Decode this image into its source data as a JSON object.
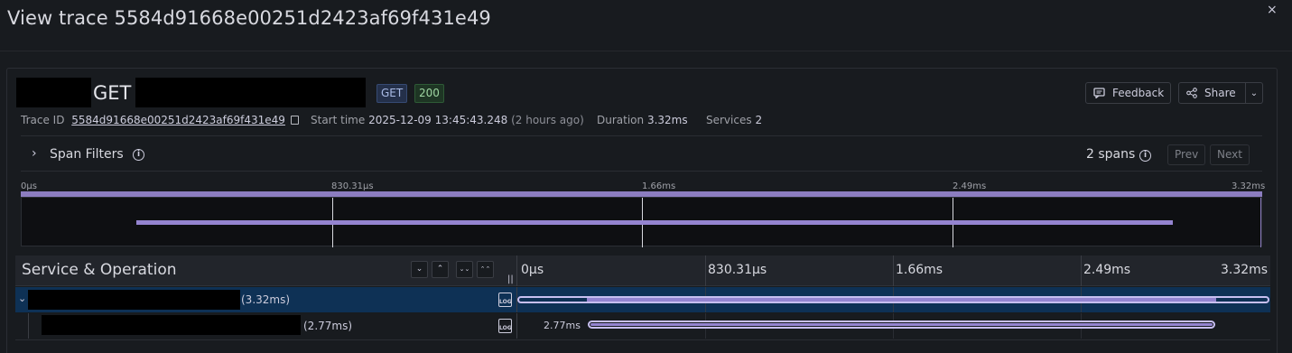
{
  "page": {
    "title": "View trace 5584d91668e00251d2423af69f431e49",
    "close_glyph": "×"
  },
  "trace": {
    "name_visible": "GET",
    "badges": [
      "GET",
      "200"
    ],
    "trace_id_label": "Trace ID",
    "trace_id": "5584d91668e00251d2423af69f431e49",
    "start_time_label": "Start time",
    "start_time": "2025-12-09 13:45:43.248",
    "start_time_relative": "(2 hours ago)",
    "duration_label": "Duration",
    "duration": "3.32ms",
    "services_label": "Services",
    "services": "2"
  },
  "actions": {
    "feedback": "Feedback",
    "share": "Share"
  },
  "filters": {
    "label": "Span Filters",
    "spans_count": "2 spans",
    "prev": "Prev",
    "next": "Next"
  },
  "minimap": {
    "ticks": [
      "0µs",
      "830.31µs",
      "1.66ms",
      "2.49ms",
      "3.32ms"
    ]
  },
  "header": {
    "title": "Service & Operation",
    "ticks": [
      "0µs",
      "830.31µs",
      "1.66ms",
      "2.49ms",
      "3.32ms"
    ]
  },
  "spans": [
    {
      "duration": "(3.32ms)",
      "start_fraction": 0.0,
      "end_fraction": 1.0,
      "label": ""
    },
    {
      "duration": "(2.77ms)",
      "start_fraction": 0.094,
      "end_fraction": 0.928,
      "label": "2.77ms"
    }
  ],
  "icons": {
    "log": "LOG",
    "collapse": "⌄",
    "expand": "⌃",
    "collapse_all": "⌄⌄",
    "expand_all": "⌃⌃"
  }
}
